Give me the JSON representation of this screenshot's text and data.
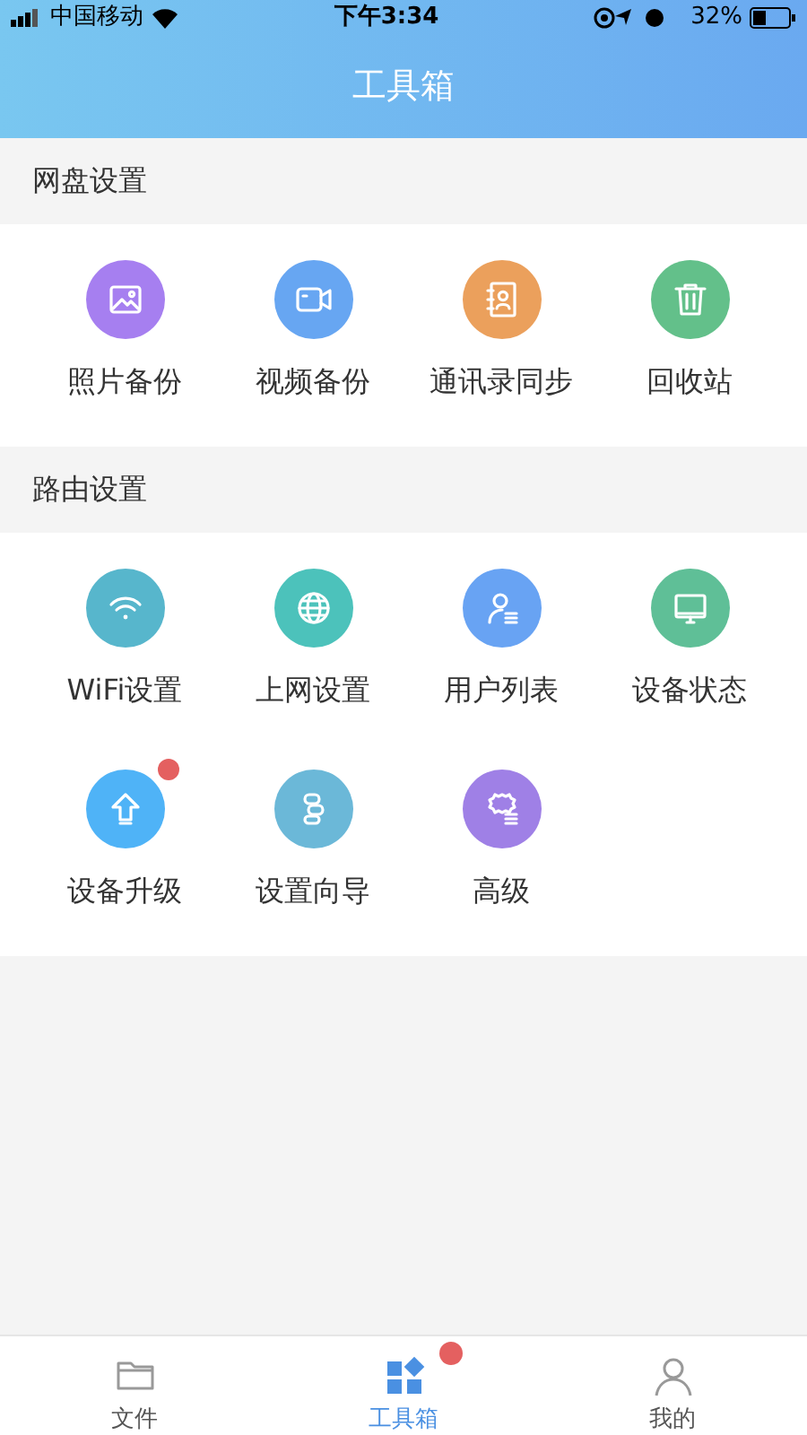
{
  "status_bar": {
    "carrier": "中国移动",
    "time": "下午3:34",
    "battery": "32%"
  },
  "header": {
    "title": "工具箱"
  },
  "sections": [
    {
      "title": "网盘设置",
      "items": [
        {
          "label": "照片备份",
          "kind": "image",
          "color": "#a67ff0",
          "badge": false
        },
        {
          "label": "视频备份",
          "kind": "video",
          "color": "#67a6f2",
          "badge": false
        },
        {
          "label": "通讯录同步",
          "kind": "contacts",
          "color": "#eba05c",
          "badge": false
        },
        {
          "label": "回收站",
          "kind": "trash",
          "color": "#63c08a",
          "badge": false
        }
      ]
    },
    {
      "title": "路由设置",
      "items": [
        {
          "label": "WiFi设置",
          "kind": "wifi",
          "color": "#57b6cc",
          "badge": false
        },
        {
          "label": "上网设置",
          "kind": "globe",
          "color": "#4cc2bb",
          "badge": false
        },
        {
          "label": "用户列表",
          "kind": "user",
          "color": "#68a3f3",
          "badge": false
        },
        {
          "label": "设备状态",
          "kind": "monitor",
          "color": "#5fbf97",
          "badge": false
        },
        {
          "label": "设备升级",
          "kind": "upgrade",
          "color": "#4fb3f7",
          "badge": true
        },
        {
          "label": "设置向导",
          "kind": "wizard",
          "color": "#6bb8d8",
          "badge": false
        },
        {
          "label": "高级",
          "kind": "gear",
          "color": "#9f80e6",
          "badge": false
        }
      ]
    }
  ],
  "tab_bar": [
    {
      "label": "文件",
      "kind": "folder",
      "selected": false,
      "badge": false
    },
    {
      "label": "工具箱",
      "kind": "tools",
      "selected": true,
      "badge": true
    },
    {
      "label": "我的",
      "kind": "person",
      "selected": false,
      "badge": false
    }
  ]
}
